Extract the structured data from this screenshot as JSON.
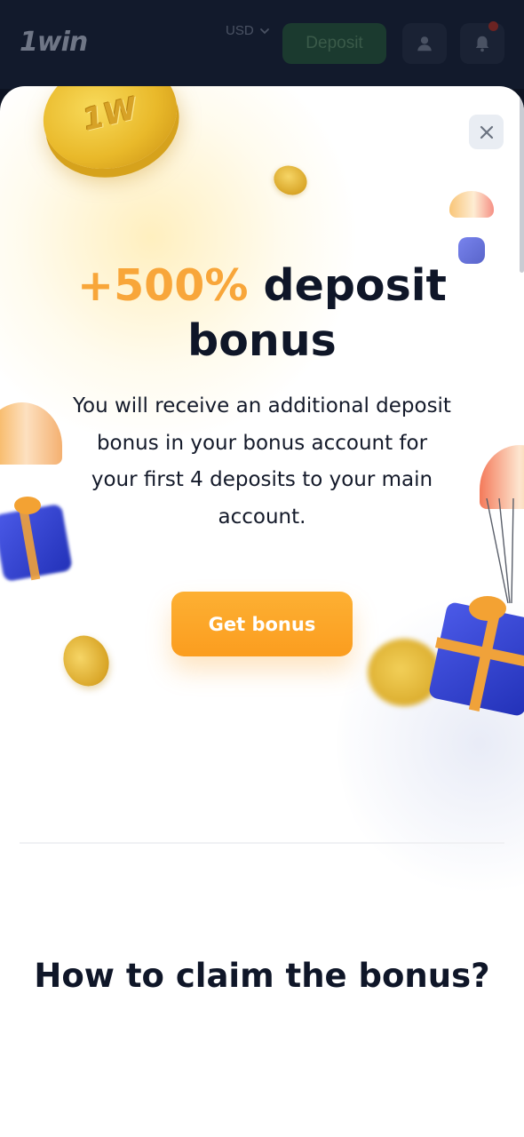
{
  "header": {
    "logo": "1win",
    "currency": "USD",
    "deposit_label": "Deposit",
    "has_notification": true
  },
  "modal": {
    "close_label": "×",
    "headline_accent": "+500%",
    "headline_rest_1": "deposit",
    "headline_rest_2": "bonus",
    "description": "You will receive an additional deposit bonus in your bonus account for your first 4 deposits to your main account.",
    "cta_label": "Get bonus",
    "coin_mark": "1W",
    "section_title": "How to claim the bonus?"
  },
  "colors": {
    "accent_orange": "#f8a63a",
    "cta_orange": "#fca62a",
    "text_dark": "#0f1628",
    "header_bg": "#121a2c",
    "deposit_green": "#1b3a2f"
  },
  "icons": {
    "currency_dropdown": "chevron-down-icon",
    "user": "user-icon",
    "bell": "bell-icon",
    "close": "close-icon"
  }
}
